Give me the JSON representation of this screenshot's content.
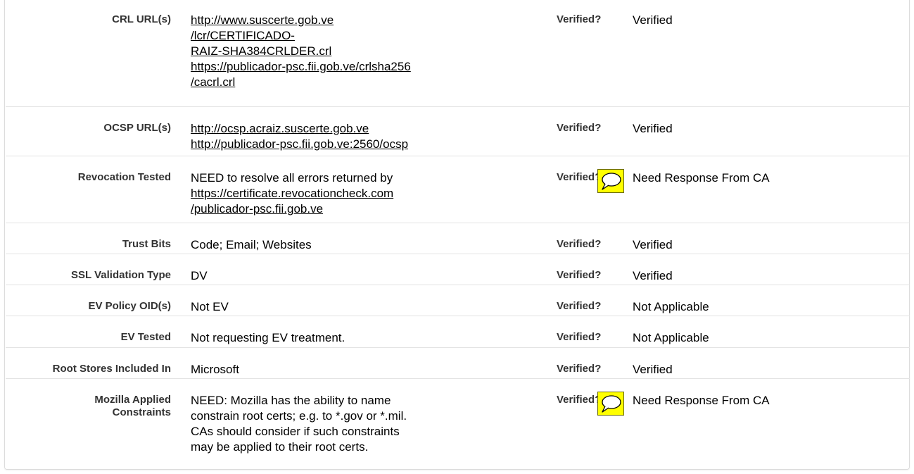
{
  "rows": [
    {
      "label": "CRL URL(s)",
      "links": [
        "http://www.suscerte.gob.ve",
        "/lcr/CERTIFICADO-",
        "RAIZ-SHA384CRLDER.crl",
        "https://publicador-psc.fii.gob.ve/crlsha256",
        "/cacrl.crl"
      ],
      "verified_label": "Verified?",
      "status": "Verified"
    },
    {
      "label": "OCSP URL(s)",
      "links": [
        "http://ocsp.acraiz.suscerte.gob.ve",
        "http://publicador-psc.fii.gob.ve:2560/ocsp"
      ],
      "verified_label": "Verified?",
      "status": "Verified"
    },
    {
      "label": "Revocation Tested",
      "text": "NEED to resolve all errors returned by",
      "links": [
        "https://certificate.revocationcheck.com",
        "/publicador-psc.fii.gob.ve"
      ],
      "verified_label": "Verified?",
      "status": "Need Response From CA",
      "note_icon": "speech-bubble-icon"
    },
    {
      "label": "Trust Bits",
      "text": "Code; Email; Websites",
      "verified_label": "Verified?",
      "status": "Verified"
    },
    {
      "label": "SSL Validation Type",
      "text": "DV",
      "verified_label": "Verified?",
      "status": "Verified"
    },
    {
      "label": "EV Policy OID(s)",
      "text": "Not EV",
      "verified_label": "Verified?",
      "status": "Not Applicable"
    },
    {
      "label": "EV Tested",
      "text": "Not requesting EV treatment.",
      "verified_label": "Verified?",
      "status": "Not Applicable"
    },
    {
      "label": "Root Stores Included In",
      "text": "Microsoft",
      "verified_label": "Verified?",
      "status": "Verified"
    },
    {
      "label_lines": [
        "Mozilla Applied",
        "Constraints"
      ],
      "text_lines": [
        "NEED: Mozilla has the ability to name",
        "constrain root certs; e.g. to *.gov or *.mil.",
        "CAs should consider if such constraints",
        "may be applied to their root certs."
      ],
      "verified_label": "Verified?",
      "status": "Need Response From CA",
      "note_icon": "speech-bubble-icon"
    }
  ],
  "colors": {
    "note_bg": "#ffff00",
    "row_divider": "#e3e3e3"
  }
}
